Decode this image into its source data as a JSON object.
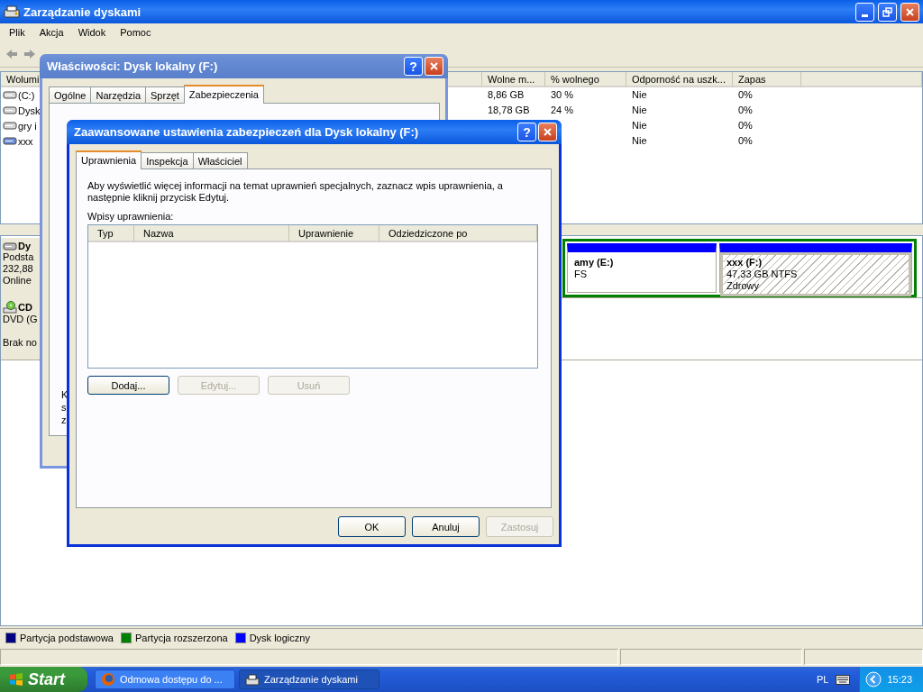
{
  "main_window": {
    "title": "Zarządzanie dyskami",
    "menu": [
      "Plik",
      "Akcja",
      "Widok",
      "Pomoc"
    ],
    "volume_table": {
      "columns": [
        "Wolumi",
        "Wolne m...",
        "% wolnego",
        "Odporność na uszk...",
        "Zapas"
      ],
      "rows": [
        {
          "volume": "(C:)",
          "free": "8,86 GB",
          "percent": "30 %",
          "fault_tolerance": "Nie",
          "overhead": "0%"
        },
        {
          "volume": "Dysk",
          "free": "18,78 GB",
          "percent": "24 %",
          "fault_tolerance": "Nie",
          "overhead": "0%"
        },
        {
          "volume": "gry i",
          "fault_tolerance": "Nie",
          "overhead": "0%"
        },
        {
          "volume": "xxx",
          "fault_tolerance": "Nie",
          "overhead": "0%"
        }
      ]
    },
    "disks": [
      {
        "kind": "disk",
        "name": "Dy",
        "lines": [
          "Podsta",
          "232,88",
          "Online"
        ],
        "partitions": [
          {
            "title": "amy (E:)",
            "lines": [
              "FS"
            ],
            "selected": false
          },
          {
            "title": "xxx (F:)",
            "lines": [
              "47,33 GB NTFS",
              "Zdrowy"
            ],
            "selected": true
          }
        ]
      },
      {
        "kind": "cdrom",
        "name": "CD",
        "lines": [
          "DVD (G",
          "Brak no"
        ]
      }
    ],
    "legend": [
      {
        "label": "Partycja podstawowa",
        "color": "#000080"
      },
      {
        "label": "Partycja rozszerzona",
        "color": "#008000"
      },
      {
        "label": "Dysk logiczny",
        "color": "#0000ff"
      }
    ]
  },
  "properties_dialog": {
    "title": "Właściwości: Dysk lokalny (F:)",
    "help_glyph": "?",
    "tabs": [
      {
        "label": "Ogólne",
        "selected": false
      },
      {
        "label": "Narzędzia",
        "selected": false
      },
      {
        "label": "Sprzęt",
        "selected": false
      },
      {
        "label": "Zabezpieczenia",
        "selected": true
      }
    ],
    "partial_lines": [
      "K",
      "s",
      "z"
    ]
  },
  "advanced_dialog": {
    "title": "Zaawansowane ustawienia zabezpieczeń dla Dysk lokalny (F:)",
    "help_glyph": "?",
    "tabs": [
      {
        "label": "Uprawnienia",
        "selected": true
      },
      {
        "label": "Inspekcja",
        "selected": false
      },
      {
        "label": "Właściciel",
        "selected": false
      }
    ],
    "description": "Aby wyświetlić więcej informacji na temat uprawnień specjalnych, zaznacz wpis uprawnienia, a następnie kliknij przycisk Edytuj.",
    "entries_label": "Wpisy uprawnienia:",
    "columns": [
      "Typ",
      "Nazwa",
      "Uprawnienie",
      "Odziedziczone po"
    ],
    "entry_buttons": [
      {
        "label": "Dodaj...",
        "disabled": false
      },
      {
        "label": "Edytuj...",
        "disabled": true
      },
      {
        "label": "Usuń",
        "disabled": true
      }
    ],
    "footer_buttons": [
      {
        "label": "OK",
        "disabled": false
      },
      {
        "label": "Anuluj",
        "disabled": false
      },
      {
        "label": "Zastosuj",
        "disabled": true
      }
    ]
  },
  "taskbar": {
    "start": "Start",
    "tasks": [
      {
        "label": "Odmowa dostępu do ...",
        "selected": false
      },
      {
        "label": "Zarządzanie dyskami",
        "selected": true
      }
    ],
    "language": "PL",
    "clock": "15:23"
  }
}
